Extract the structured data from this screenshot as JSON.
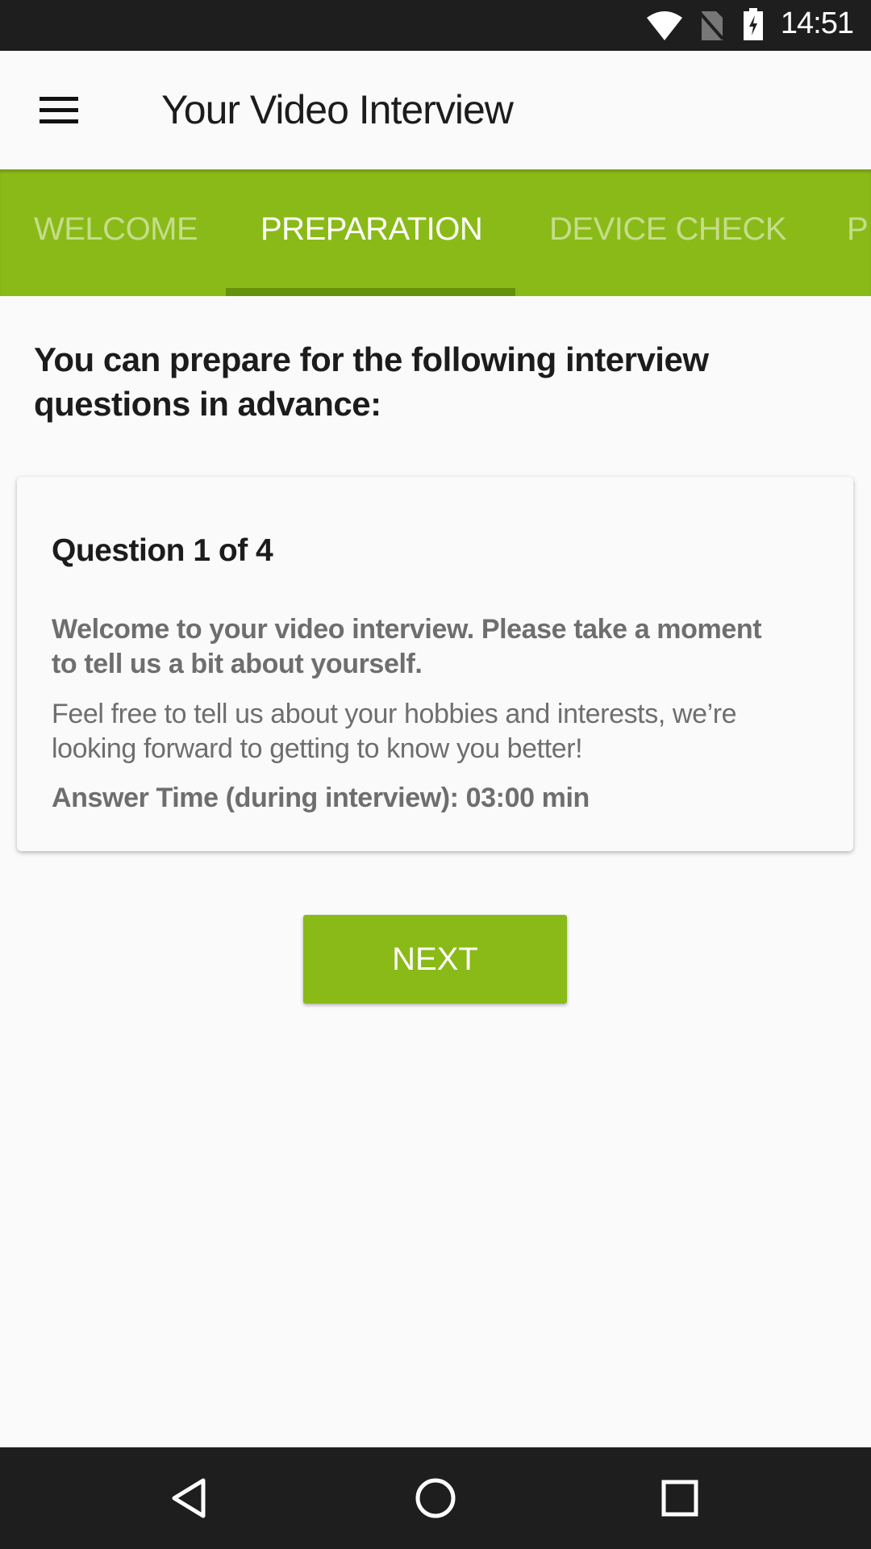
{
  "status_bar": {
    "time": "14:51",
    "icons": [
      "wifi-icon",
      "no-sim-icon",
      "battery-charging-icon"
    ]
  },
  "app_bar": {
    "title": "Your Video Interview",
    "menu_icon": "hamburger-menu-icon"
  },
  "tabs": [
    {
      "label": "WELCOME",
      "active": false
    },
    {
      "label": "PREPARATION",
      "active": true
    },
    {
      "label": "DEVICE CHECK",
      "active": false
    },
    {
      "label": "P",
      "active": false
    }
  ],
  "main": {
    "heading_lines": [
      "You can prepare for the following interview",
      "questions in advance:"
    ],
    "card": {
      "title": "Question 1 of 4",
      "question_lines": [
        "Welcome to your video interview. Please take a moment",
        "to tell us a bit about yourself."
      ],
      "description_lines": [
        "Feel free to tell us about your hobbies and interests, we’re",
        "looking forward to getting to know you better!"
      ],
      "answer_time": "Answer Time (during interview): 03:00 min"
    },
    "next_label": "NEXT"
  },
  "colors": {
    "accent": "#8aba17",
    "indicator": "#67900c",
    "system_bar": "#1e1e1e"
  },
  "nav_bar": {
    "icons": [
      "back-icon",
      "home-icon",
      "recents-icon"
    ]
  }
}
